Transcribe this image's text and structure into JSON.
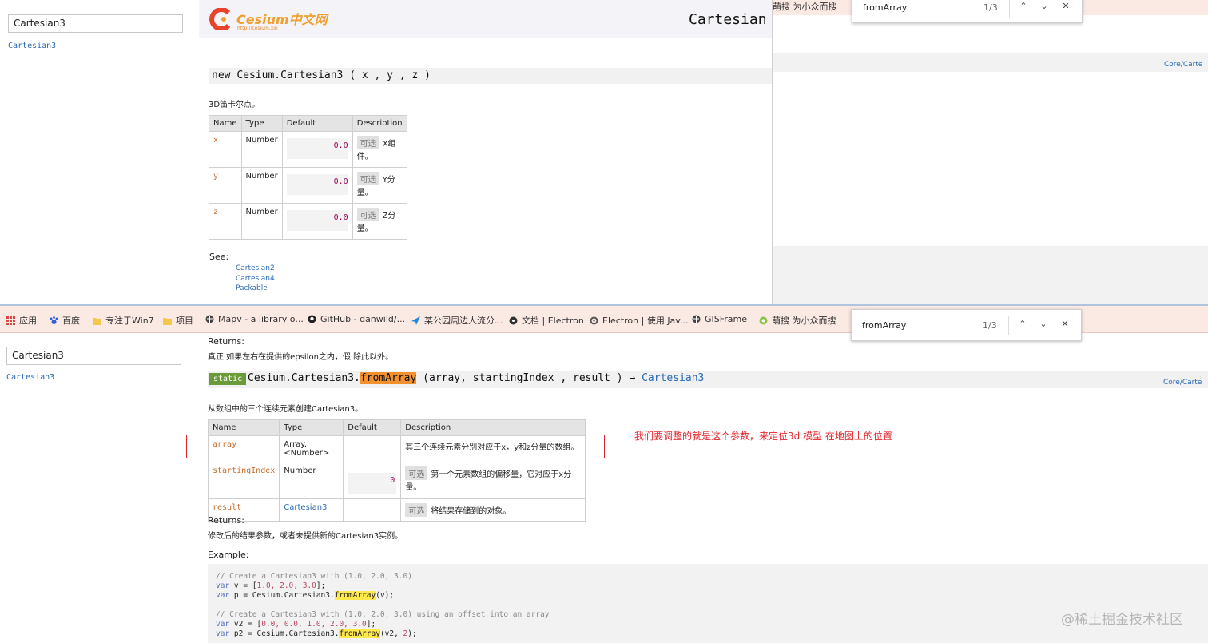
{
  "top": {
    "search_value": "Cartesian3",
    "side_link": "Cartesian3",
    "logo_text": "Cesium中文网",
    "logo_url": "http://cesium.xin",
    "header_title": "Cartesian",
    "bookmark_fragment": "萌搜 为小众而搜",
    "core_link": "Core/Carte",
    "constructor": {
      "sig_prefix": "new",
      "sig_name": "Cesium.Cartesian3",
      "sig_args": "( x , y , z )"
    },
    "description": "3D笛卡尔点。",
    "table": {
      "headers": [
        "Name",
        "Type",
        "Default",
        "Description"
      ],
      "rows": [
        {
          "name": "x",
          "type": "Number",
          "default": "0.0",
          "optional": "可选",
          "desc": "X组件。"
        },
        {
          "name": "y",
          "type": "Number",
          "default": "0.0",
          "optional": "可选",
          "desc": "Y分量。"
        },
        {
          "name": "z",
          "type": "Number",
          "default": "0.0",
          "optional": "可选",
          "desc": "Z分量。"
        }
      ]
    },
    "see_label": "See:",
    "see_links": [
      "Cartesian2",
      "Cartesian4",
      "Packable"
    ],
    "find": {
      "query": "fromArray",
      "count": "1/3"
    }
  },
  "bottom": {
    "bookmarks": [
      {
        "label": "应用",
        "icon": "apps-grid-icon"
      },
      {
        "label": "百度",
        "icon": "baidu-paw-icon"
      },
      {
        "label": "专注于Win7",
        "icon": "folder-icon"
      },
      {
        "label": "项目",
        "icon": "folder-icon"
      },
      {
        "label": "Mapv - a library o...",
        "icon": "globe-icon"
      },
      {
        "label": "GitHub - danwild/...",
        "icon": "github-icon"
      },
      {
        "label": "某公园周边人流分...",
        "icon": "arrow-icon"
      },
      {
        "label": "文档 | Electron",
        "icon": "electron-icon"
      },
      {
        "label": "Electron | 使用 Jav...",
        "icon": "gear-icon"
      },
      {
        "label": "GISFrame",
        "icon": "globe-icon"
      },
      {
        "label": "萌搜 为小众而搜",
        "icon": "circle-icon"
      }
    ],
    "find": {
      "query": "fromArray",
      "count": "1/3"
    },
    "search_value": "Cartesian3",
    "side_link": "Cartesian3",
    "returns1_label": "Returns:",
    "returns1_text": "真正 如果左右在提供的epsilon之内，假 除此以外。",
    "static_badge": "static",
    "sig": {
      "prefix": "Cesium.Cartesian3.",
      "method": "fromArray",
      "args": " (array, startingIndex , result ) → ",
      "return_type": "Cartesian3"
    },
    "core_link": "Core/Carte",
    "description": "从数组中的三个连续元素创建Cartesian3。",
    "table": {
      "headers": [
        "Name",
        "Type",
        "Default",
        "Description"
      ],
      "rows": [
        {
          "name": "array",
          "type": "Array.<Number>",
          "default": "",
          "optional": "",
          "desc": "其三个连续元素分别对应于x，y和z分量的数组。"
        },
        {
          "name": "startingIndex",
          "type": "Number",
          "default": "0",
          "optional": "可选",
          "desc": "第一个元素数组的偏移量，它对应于x分量。"
        },
        {
          "name": "result",
          "type": "Cartesian3",
          "default": "",
          "optional": "可选",
          "desc": "将结果存储到的对象。"
        }
      ]
    },
    "annotation": "我们要调整的就是这个参数，来定位3d 模型 在地图上的位置",
    "returns2_label": "Returns:",
    "returns2_text": "修改后的结果参数，或者未提供新的Cartesian3实例。",
    "example_label": "Example:",
    "code": {
      "c1": "// Create a Cartesian3 with (1.0, 2.0, 3.0)",
      "l2_kw": "var",
      "l2_rest": " v = [",
      "l2_nums": "1.0, 2.0, 3.0",
      "l2_end": "];",
      "l3_kw": "var",
      "l3_rest": " p = Cesium.Cartesian3.",
      "l3_fn": "fromArray",
      "l3_end": "(v);",
      "c2": "// Create a Cartesian3 with (1.0, 2.0, 3.0) using an offset into an array",
      "l5_kw": "var",
      "l5_rest": " v2 = [",
      "l5_nums": "0.0, 0.0, 1.0, 2.0, 3.0",
      "l5_end": "];",
      "l6_kw": "var",
      "l6_rest": " p2 = Cesium.Cartesian3.",
      "l6_fn": "fromArray",
      "l6_mid": "(v2, ",
      "l6_num": "2",
      "l6_end": ");"
    },
    "watermark": "@稀土掘金技术社区"
  }
}
